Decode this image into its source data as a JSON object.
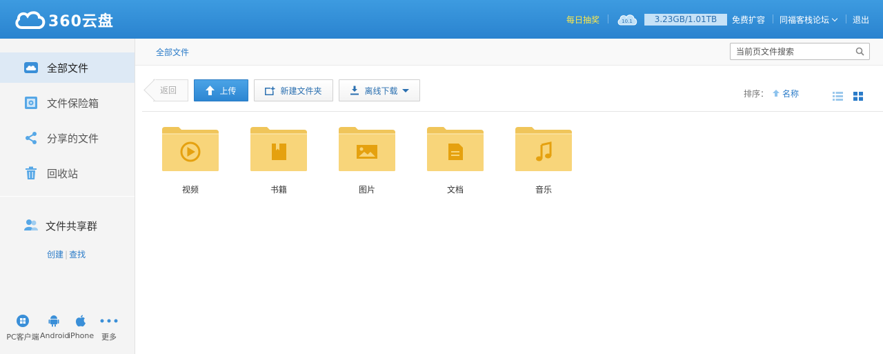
{
  "header": {
    "logo_text": "360云盘",
    "lottery": "每日抽奖",
    "badge": "10.1",
    "quota": "3.23GB/1.01TB",
    "quota_used_fraction": 0.003,
    "expand": "免费扩容",
    "forum": "同福客栈论坛",
    "logout": "退出"
  },
  "sidebar": {
    "items": [
      {
        "label": "全部文件",
        "icon": "cloud-icon"
      },
      {
        "label": "文件保险箱",
        "icon": "safe-icon"
      },
      {
        "label": "分享的文件",
        "icon": "share-icon"
      },
      {
        "label": "回收站",
        "icon": "trash-icon"
      }
    ],
    "group_title": "文件共享群",
    "group_create": "创建",
    "group_find": "查找",
    "clients": [
      {
        "label": "PC客户端",
        "icon": "windows-icon"
      },
      {
        "label": "Android",
        "icon": "android-icon"
      },
      {
        "label": "iPhone",
        "icon": "apple-icon"
      },
      {
        "label": "更多",
        "icon": "more-icon"
      }
    ]
  },
  "main": {
    "breadcrumb": "全部文件",
    "search_placeholder": "当前页文件搜索",
    "toolbar": {
      "back": "返回",
      "upload": "上传",
      "new_folder": "新建文件夹",
      "offline_download": "离线下载"
    },
    "sort_label": "排序：",
    "sort_field": "名称",
    "folders": [
      {
        "name": "视频",
        "icon": "play-icon"
      },
      {
        "name": "书籍",
        "icon": "book-icon"
      },
      {
        "name": "图片",
        "icon": "image-icon"
      },
      {
        "name": "文档",
        "icon": "document-icon"
      },
      {
        "name": "音乐",
        "icon": "music-icon"
      }
    ]
  },
  "colors": {
    "header_blue": "#2f8ad3",
    "link_blue": "#2a7bc8",
    "lottery_yellow": "#ffe94a",
    "folder_yellow": "#f7cf6a",
    "folder_icon": "#e5a10f"
  }
}
